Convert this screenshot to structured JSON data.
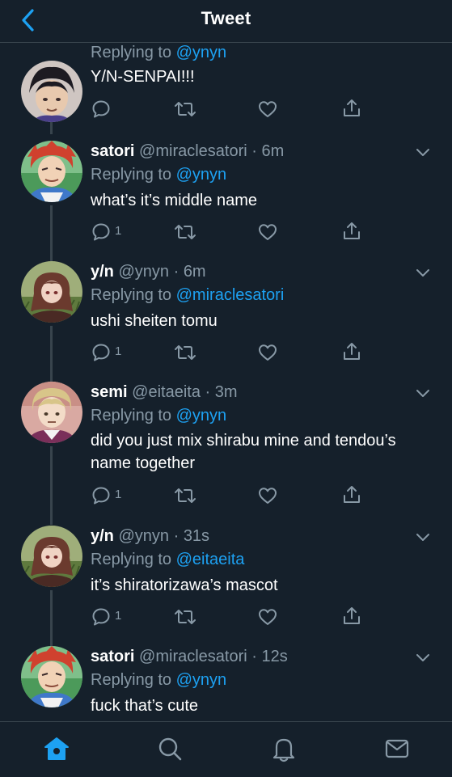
{
  "header": {
    "title": "Tweet"
  },
  "tweets": [
    {
      "name": "",
      "handle": "",
      "dot": "",
      "time": "",
      "replying_prefix": "Replying to ",
      "replying_to": "@ynyn",
      "text": "Y/N-SENPAI!!!",
      "reply_count": ""
    },
    {
      "name": "satori",
      "handle": "@miraclesatori",
      "dot": " · ",
      "time": "6m",
      "replying_prefix": "Replying to ",
      "replying_to": "@ynyn",
      "text": "what’s it’s middle name",
      "reply_count": "1"
    },
    {
      "name": "y/n",
      "handle": "@ynyn",
      "dot": " · ",
      "time": "6m",
      "replying_prefix": "Replying to ",
      "replying_to": "@miraclesatori",
      "text": "ushi sheiten tomu",
      "reply_count": "1"
    },
    {
      "name": "semi",
      "handle": "@eitaeita",
      "dot": " · ",
      "time": "3m",
      "replying_prefix": "Replying to ",
      "replying_to": "@ynyn",
      "text": "did you just mix shirabu mine and tendou’s name together",
      "reply_count": "1"
    },
    {
      "name": "y/n",
      "handle": "@ynyn",
      "dot": " · ",
      "time": "31s",
      "replying_prefix": "Replying to ",
      "replying_to": "@eitaeita",
      "text": "it’s shiratorizawa’s mascot",
      "reply_count": "1"
    },
    {
      "name": "satori",
      "handle": "@miraclesatori",
      "dot": " · ",
      "time": "12s",
      "replying_prefix": "Replying to ",
      "replying_to": "@ynyn",
      "text": "fuck that’s cute",
      "reply_count": ""
    }
  ],
  "icons": {
    "back": "chevron-left-icon",
    "reply": "comment-bubble-icon",
    "retweet": "retweet-arrows-icon",
    "like": "heart-outline-icon",
    "share": "share-upload-icon",
    "more": "chevron-down-icon",
    "tabs": [
      "home-icon",
      "search-icon",
      "bell-icon",
      "mail-icon"
    ]
  },
  "colors": {
    "background": "#15202b",
    "border": "#38444d",
    "accent": "#1da1f2",
    "secondary_text": "#8899a6"
  }
}
